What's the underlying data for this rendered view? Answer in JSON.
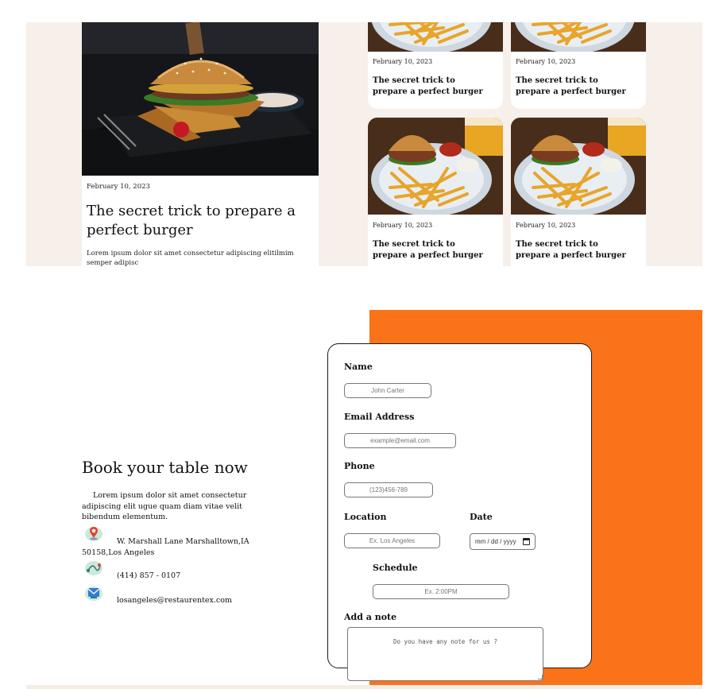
{
  "blog": {
    "featured": {
      "date": "February 10, 2023",
      "title": "The secret trick to prepare a perfect burger",
      "excerpt": "Lorem ipsum dolor sit amet consectetur adipiscing elitilmim semper adipisc"
    },
    "cards": [
      {
        "date": "February 10, 2023",
        "title": "The secret trick to prepare a perfect burger"
      },
      {
        "date": "February 10, 2023",
        "title": "The secret trick to prepare a perfect burger"
      },
      {
        "date": "February 10, 2023",
        "title": "The secret trick to prepare a perfect burger"
      },
      {
        "date": "February 10, 2023",
        "title": "The secret trick to prepare a perfect burger"
      }
    ]
  },
  "reservation": {
    "title": "Book your table now",
    "description": "Lorem ipsum dolor sit amet consectetur adipiscing elit ugue quam diam vitae velit bibendum elementum.",
    "contact": {
      "address": "W. Marshall Lane Marshalltown,IA 50158,Los Angeles",
      "phone": "(414) 857 - 0107",
      "email": "losangeles@restaurentex.com"
    },
    "form": {
      "name_label": "Name",
      "name_placeholder": "John Carter",
      "email_label": "Email Address",
      "email_placeholder": "example@email.com",
      "phone_label": "Phone",
      "phone_placeholder": "(123)456-789",
      "location_label": "Location",
      "location_placeholder": "Ex. Los Angeles",
      "date_label": "Date",
      "date_value": "mm / dd / yyyy",
      "schedule_label": "Schedule",
      "schedule_placeholder": "Ex. 2:00PM",
      "note_label": "Add a note",
      "note_placeholder": "Do you have any note for us ?"
    }
  },
  "colors": {
    "accent": "#fa7319",
    "section_bg": "#f7f0ea"
  },
  "icons": [
    "location-pin-icon",
    "map-route-icon",
    "email-icon",
    "calendar-icon"
  ]
}
